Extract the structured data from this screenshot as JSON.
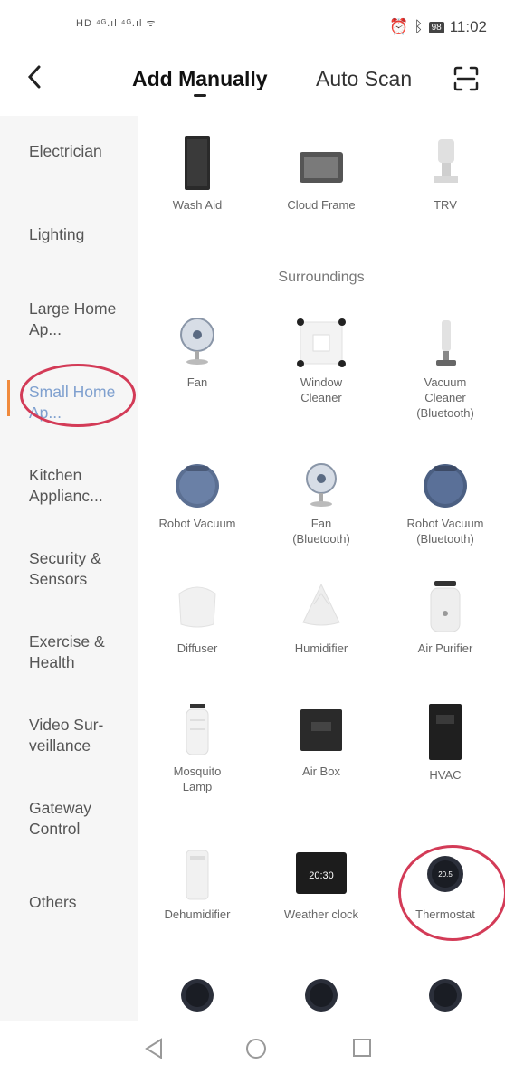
{
  "status": {
    "left_indicators": "HD ⁴ᴳ.ıl ⁴ᴳ.ıl ᯤ",
    "battery": "98",
    "time": "11:02"
  },
  "header": {
    "tab_add_manually": "Add Manually",
    "tab_auto_scan": "Auto Scan"
  },
  "sidebar": {
    "items": [
      {
        "label": "Electrician"
      },
      {
        "label": "Lighting"
      },
      {
        "label": "Large Home Ap..."
      },
      {
        "label": "Small Home Ap..."
      },
      {
        "label": "Kitchen Applianc..."
      },
      {
        "label": "Security & Sensors"
      },
      {
        "label": "Exercise & Health"
      },
      {
        "label": "Video Sur-veillance"
      },
      {
        "label": "Gateway Control"
      },
      {
        "label": "Others"
      }
    ]
  },
  "content": {
    "top_row": [
      {
        "label": "Wash Aid",
        "icon": "wash-aid-icon"
      },
      {
        "label": "Cloud Frame",
        "icon": "cloud-frame-icon"
      },
      {
        "label": "TRV",
        "icon": "trv-icon"
      }
    ],
    "section_title": "Surroundings",
    "devices": [
      {
        "label": "Fan",
        "icon": "fan-icon"
      },
      {
        "label": "Window\nCleaner",
        "icon": "window-cleaner-icon"
      },
      {
        "label": "Vacuum\nCleaner\n(Bluetooth)",
        "icon": "vacuum-cleaner-icon"
      },
      {
        "label": "Robot Vacuum",
        "icon": "robot-vacuum-icon"
      },
      {
        "label": "Fan\n(Bluetooth)",
        "icon": "fan-icon"
      },
      {
        "label": "Robot Vacuum\n(Bluetooth)",
        "icon": "robot-vacuum-icon"
      },
      {
        "label": "Diffuser",
        "icon": "diffuser-icon"
      },
      {
        "label": "Humidifier",
        "icon": "humidifier-icon"
      },
      {
        "label": "Air Purifier",
        "icon": "air-purifier-icon"
      },
      {
        "label": "Mosquito\nLamp",
        "icon": "mosquito-lamp-icon"
      },
      {
        "label": "Air Box",
        "icon": "air-box-icon"
      },
      {
        "label": "HVAC",
        "icon": "hvac-icon"
      },
      {
        "label": "Dehumidifier",
        "icon": "dehumidifier-icon"
      },
      {
        "label": "Weather clock",
        "icon": "weather-clock-icon"
      },
      {
        "label": "Thermostat",
        "icon": "thermostat-icon"
      }
    ],
    "bottom_partial": [
      {
        "icon": "thermostat-icon"
      },
      {
        "icon": "thermostat-icon"
      },
      {
        "icon": "thermostat-icon"
      }
    ],
    "thermostat_reading": "20.5",
    "weather_clock_time": "20:30"
  },
  "colors": {
    "active_sidebar_text": "#7fa0cf",
    "active_marker": "#f08a3c",
    "annotation_circle": "#d33b57"
  }
}
